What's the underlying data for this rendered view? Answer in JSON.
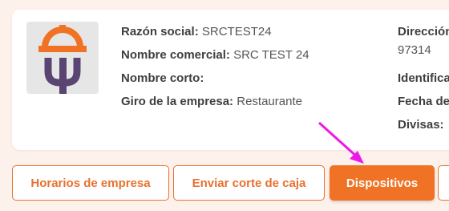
{
  "company": {
    "fields": [
      {
        "label": "Razón social:",
        "value": "SRCTEST24"
      },
      {
        "label": "Nombre comercial:",
        "value": "SRC TEST 24"
      },
      {
        "label": "Nombre corto:",
        "value": ""
      },
      {
        "label": "Giro de la empresa:",
        "value": "Restaurante"
      }
    ],
    "right_fields": [
      {
        "label": "Dirección",
        "value": "97314"
      },
      {
        "label": "Identifica",
        "value": ""
      },
      {
        "label": "Fecha de",
        "value": ""
      },
      {
        "label": "Divisas:",
        "value": ""
      }
    ]
  },
  "buttons": {
    "horarios": "Horarios de empresa",
    "corte": "Enviar corte de caja",
    "dispositivos": "Dispositivos"
  },
  "colors": {
    "accent": "#f07224",
    "logo_orange": "#f07224",
    "logo_purple": "#5a4572",
    "annotation_arrow": "#ee18e6"
  },
  "icons": {
    "logo": "restaurant-cloche-logo",
    "annotation": "arrow-pointer-icon"
  }
}
